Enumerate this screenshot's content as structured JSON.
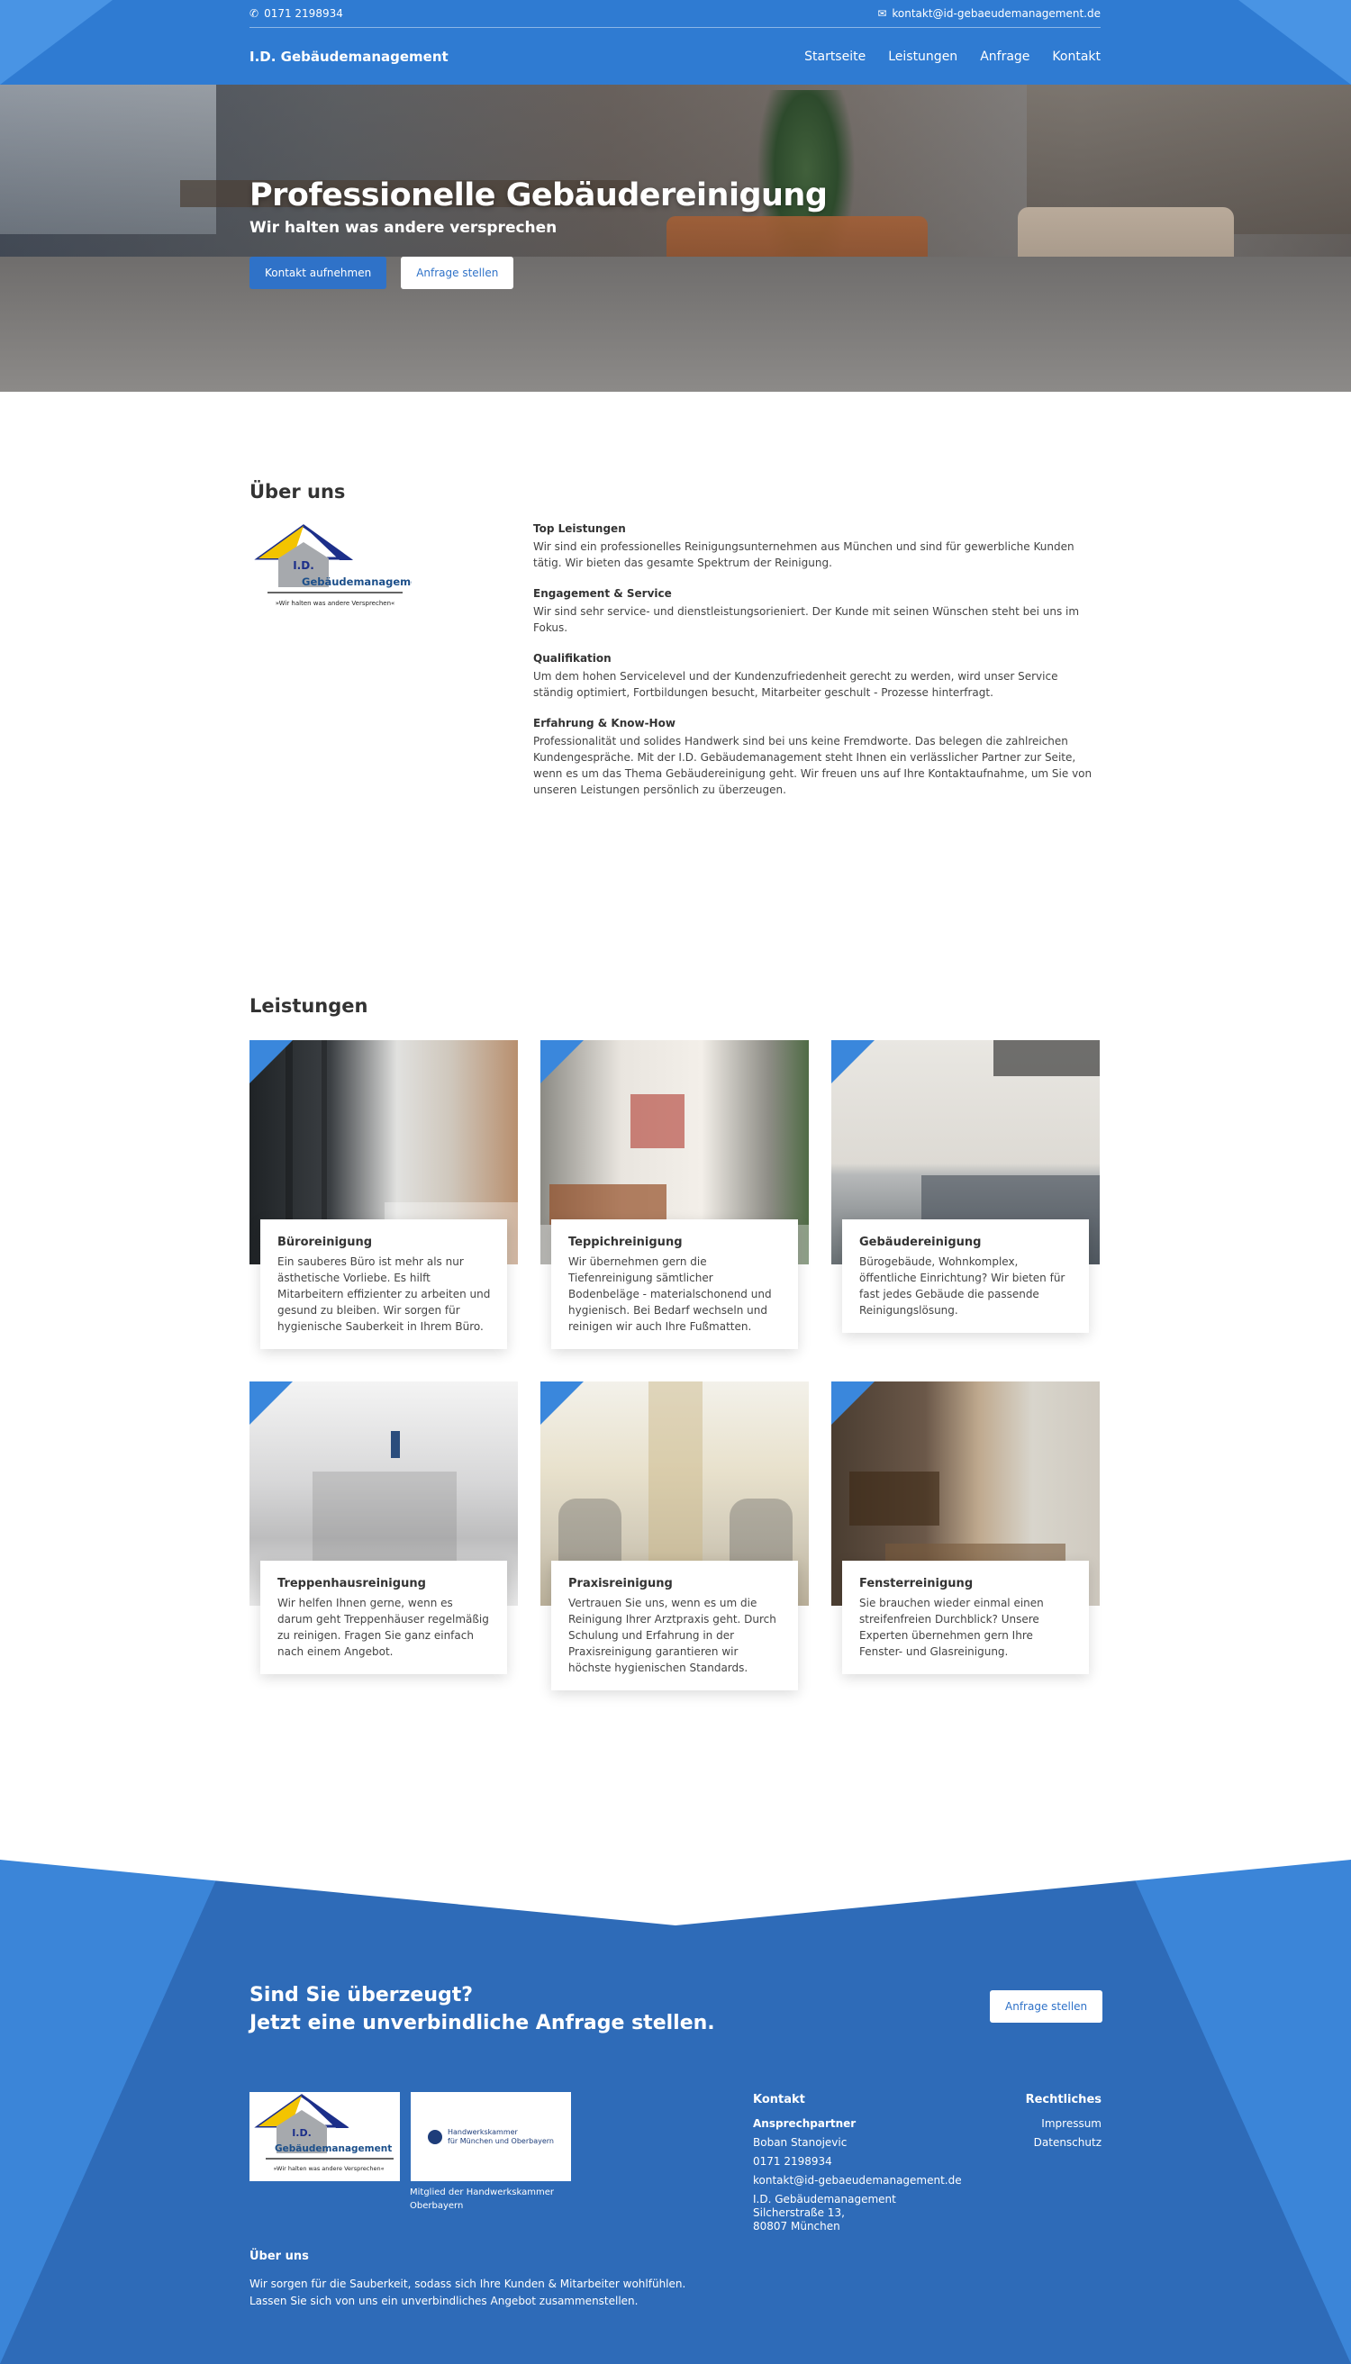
{
  "topbar": {
    "phone": "0171 2198934",
    "email": "kontakt@id-gebaeudemanagement.de"
  },
  "nav": {
    "brand": "I.D. Gebäudemanagement",
    "items": [
      "Startseite",
      "Leistungen",
      "Anfrage",
      "Kontakt"
    ]
  },
  "hero": {
    "title": "Professionelle Gebäudereinigung",
    "subtitle": "Wir halten was andere versprechen",
    "btn_contact": "Kontakt aufnehmen",
    "btn_request": "Anfrage stellen"
  },
  "logo": {
    "line1": "I.D.",
    "line2": "Gebäudemanagement",
    "tagline": "»Wir halten was andere Versprechen«"
  },
  "about": {
    "title": "Über uns",
    "items": [
      {
        "heading": "Top Leistungen",
        "text": "Wir sind ein professionelles Reinigungsunternehmen aus München und sind für gewerbliche Kunden tätig. Wir bieten das gesamte Spektrum der Reinigung."
      },
      {
        "heading": "Engagement & Service",
        "text": "Wir sind sehr service- und dienstleistungsorieniert. Der Kunde mit seinen Wünschen steht bei uns im Fokus."
      },
      {
        "heading": "Qualifikation",
        "text": "Um dem hohen Servicelevel und der Kundenzufriedenheit gerecht zu werden, wird unser Service ständig optimiert, Fortbildungen besucht, Mitarbeiter geschult - Prozesse hinterfragt."
      },
      {
        "heading": "Erfahrung & Know-How",
        "text": "Professionalität und solides Handwerk sind bei uns keine Fremdworte. Das belegen die zahlreichen Kundengespräche. Mit der I.D. Gebäudemanagement steht Ihnen ein verlässlicher Partner zur Seite, wenn es um das Thema Gebäudereinigung geht. Wir freuen uns auf Ihre Kontaktaufnahme, um Sie von unseren Leistungen persönlich zu überzeugen."
      }
    ]
  },
  "services": {
    "title": "Leistungen",
    "cards": [
      {
        "title": "Büroreinigung",
        "text": "Ein sauberes Büro ist mehr als nur ästhetische Vorliebe. Es hilft Mitarbeitern effizienter zu arbeiten und gesund zu bleiben. Wir sorgen für hygienische Sauberkeit in Ihrem Büro."
      },
      {
        "title": "Teppichreinigung",
        "text": "Wir übernehmen gern die Tiefenreinigung sämtlicher Bodenbeläge - materialschonend und hygienisch. Bei Bedarf wechseln und reinigen wir auch Ihre Fußmatten."
      },
      {
        "title": "Gebäudereinigung",
        "text": "Bürogebäude, Wohnkomplex, öffentliche Einrichtung? Wir bieten für fast jedes Gebäude die passende Reinigungslösung."
      },
      {
        "title": "Treppenhausreinigung",
        "text": "Wir helfen Ihnen gerne, wenn es darum geht Treppenhäuser regelmäßig zu reinigen. Fragen Sie ganz einfach nach einem Angebot."
      },
      {
        "title": "Praxisreinigung",
        "text": "Vertrauen Sie uns, wenn es um die Reinigung Ihrer Arztpraxis geht. Durch Schulung und Erfahrung in der Praxisreinigung garantieren wir höchste hygienischen Standards."
      },
      {
        "title": "Fensterreinigung",
        "text": "Sie brauchen wieder einmal einen streifenfreien Durchblick? Unsere Experten übernehmen gern Ihre Fenster- und Glasreinigung."
      }
    ]
  },
  "footer": {
    "cta_line1": "Sind Sie überzeugt?",
    "cta_line2": "Jetzt eine unverbindliche Anfrage stellen.",
    "cta_button": "Anfrage stellen",
    "hwk_line1": "Handwerkskammer",
    "hwk_line2": "für München und Oberbayern",
    "member": "Mitglied der Handwerkskammer Oberbayern",
    "about_title": "Über uns",
    "about_line1": "Wir sorgen für die Sauberkeit, sodass sich Ihre Kunden & Mitarbeiter wohlfühlen.",
    "about_line2": "Lassen Sie sich von uns ein unverbindliches Angebot zusammenstellen.",
    "contact_title": "Kontakt",
    "contact_label": "Ansprechpartner",
    "contact_name": "Boban Stanojevic",
    "contact_phone": "0171 2198934",
    "contact_email": "kontakt@id-gebaeudemanagement.de",
    "address_company": "I.D. Gebäudemanagement",
    "address_street": "Silcherstraße 13,",
    "address_city": "80807 München",
    "legal_title": "Rechtliches",
    "legal_impressum": "Impressum",
    "legal_datenschutz": "Datenschutz"
  },
  "colors": {
    "brand_blue": "#2f7bd2",
    "footer_blue": "#2e6bb8",
    "button_blue": "#2f72c8"
  }
}
